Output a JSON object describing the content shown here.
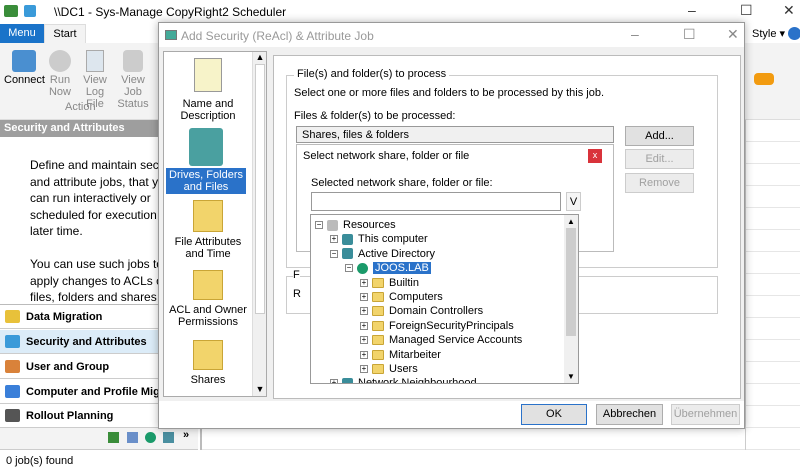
{
  "app": {
    "title": "\\\\DC1 - Sys-Manage CopyRight2 Scheduler",
    "style_label": "Style"
  },
  "ribbon": {
    "tabs": [
      {
        "label": "Menu"
      },
      {
        "label": "Start"
      }
    ],
    "buttons": [
      {
        "label": "Connect"
      },
      {
        "label": "Run Now"
      },
      {
        "label": "View Log File"
      },
      {
        "label": "View Job Status"
      }
    ],
    "group_label": "Action"
  },
  "left": {
    "header": "Security and Attributes",
    "description": [
      "Define and maintain securi",
      "and attribute jobs, that you",
      "can run interactively or",
      "scheduled for execution at",
      "later time.",
      "",
      "You can use such jobs to",
      "apply changes to ACLs of",
      "files, folders and shares"
    ],
    "nav": [
      {
        "label": "Data Migration",
        "color": "#e8c13a"
      },
      {
        "label": "Security and Attributes",
        "color": "#3a9ad9"
      },
      {
        "label": "User and Group Migration",
        "color": "#d9823a"
      },
      {
        "label": "Computer and Profile Migration",
        "color": "#3a7fd9"
      },
      {
        "label": "Rollout Planning",
        "color": "#555555"
      }
    ],
    "overflow": "»"
  },
  "status": "0 job(s) found",
  "dialog": {
    "title": "Add Security (ReAcl) & Attribute Job",
    "steps": [
      {
        "label": "Name and Description"
      },
      {
        "label": "Drives, Folders and Files",
        "selected": true
      },
      {
        "label": "File Attributes and Time"
      },
      {
        "label": "ACL and Owner Permissions"
      },
      {
        "label": "Shares"
      }
    ],
    "group_title": "File(s) and folder(s) to process",
    "intro": "Select one or more files and folders to be processed by this job.",
    "list_label": "Files & folder(s) to be processed:",
    "list_header": "Shares, files & folders",
    "add": "Add...",
    "edit": "Edit...",
    "remove": "Remove",
    "picker": {
      "title": "Select network share, folder or file",
      "close": "x",
      "field_label": "Selected network share, folder or file:",
      "value": "",
      "dropdown": "V"
    },
    "group2_letter1": "F",
    "group2_letter2": "R",
    "tree": [
      {
        "label": "Resources",
        "level": 0,
        "pm": "−"
      },
      {
        "label": "This computer",
        "level": 1,
        "pm": "+"
      },
      {
        "label": "Active Directory",
        "level": 1,
        "pm": "−"
      },
      {
        "label": "JOOS.LAB",
        "level": 2,
        "pm": "−",
        "selected": true
      },
      {
        "label": "Builtin",
        "level": 3,
        "pm": "+"
      },
      {
        "label": "Computers",
        "level": 3,
        "pm": "+"
      },
      {
        "label": "Domain Controllers",
        "level": 3,
        "pm": "+"
      },
      {
        "label": "ForeignSecurityPrincipals",
        "level": 3,
        "pm": "+"
      },
      {
        "label": "Managed Service Accounts",
        "level": 3,
        "pm": "+"
      },
      {
        "label": "Mitarbeiter",
        "level": 3,
        "pm": "+"
      },
      {
        "label": "Users",
        "level": 3,
        "pm": "+"
      },
      {
        "label": "Network Neighbourhood",
        "level": 1,
        "pm": "+"
      }
    ],
    "ok": "OK",
    "cancel": "Abbrechen",
    "apply": "Übernehmen"
  }
}
